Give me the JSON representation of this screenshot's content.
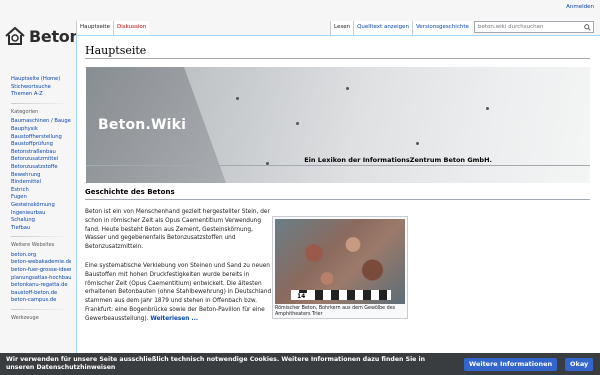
{
  "header": {
    "login": "Anmelden",
    "logo_text": "Beton"
  },
  "tabs": {
    "left": [
      "Hauptseite",
      "Diskussion"
    ],
    "right": [
      "Lesen",
      "Quelltext anzeigen",
      "Versionsgeschichte"
    ]
  },
  "search": {
    "placeholder": "beton.wiki durchsuchen"
  },
  "page": {
    "title": "Hauptseite",
    "banner_text": "Beton.Wiki",
    "subtitle": "Ein Lexikon der InformationsZentrum Beton GmbH.",
    "section_title": "Geschichte des Betons",
    "para1": "Beton ist ein von Menschenhand gezielt hergestellter Stein, der schon in römischer Zeit als Opus Caementitium Verwendung fand. Heute besteht Beton aus Zement, Gesteinskörnung, Wasser und gegebenenfalls Betonzusatzstoffen und Betonzusatzmitteln.",
    "para2": "Eine systematische Verklebung von Steinen und Sand zu neuen Baustoffen mit hohen Druckfestigkeiten wurde bereits in römischer Zeit (Opus Caementitium) entwickelt. Die ältesten erhaltenen Betonbauten (ohne Stahlbewehrung) in Deutschland stammen aus dem Jahr 1879 und stehen in Offenbach bzw. Frankfurt: eine Bogenbrücke sowie der Beton-Pavillon für eine Gewerbeausstellung).",
    "weiterlesen": "Weiterlesen ...",
    "thumb_ruler": "14",
    "thumb_caption": "Römischer Beton, Bohrkern aus dem Gewölbe des Amphitheaters Trier"
  },
  "sidebar": {
    "nav": [
      "Hauptseite (Home)",
      "Stichwortsuche",
      "Themen A-Z"
    ],
    "kategorien_head": "Kategorien",
    "kategorien": [
      "Baumaschinen / Baugeräte",
      "Bauphysik",
      "Baustoffherstellung",
      "Baustoffprüfung",
      "Betonstraßenbau",
      "Betonzusatzmittel",
      "Betonzusatzstoffe",
      "Bewehrung",
      "Bindemittel",
      "Estrich",
      "Fugen",
      "Gesteinskörnung",
      "Ingenieurbau",
      "Schalung",
      "Tiefbau"
    ],
    "websites_head": "Weitere Websites",
    "websites": [
      "beton.org",
      "beton-webakademie.de",
      "beton-fuer-grosse-ideen.de",
      "planungsatlas-hochbau.de",
      "betonkanu-regatta.de",
      "baustoff-beton.de",
      "beton-campus.de"
    ],
    "werkzeuge_head": "Werkzeuge"
  },
  "cookie": {
    "text": "Wir verwenden für unsere Seite ausschließlich technisch notwendige Cookies. Weitere Informationen dazu finden Sie in unseren Datenschutzhinweisen",
    "more_button": "Weitere Informationen",
    "ok_button": "Okay"
  }
}
